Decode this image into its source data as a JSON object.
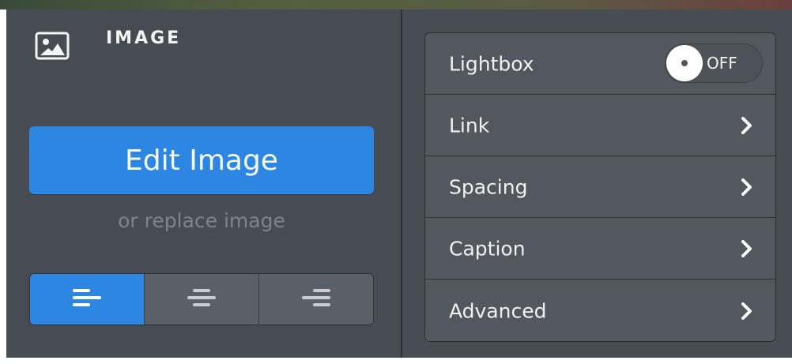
{
  "header": {
    "title": "IMAGE",
    "icon": "image-icon"
  },
  "actions": {
    "edit_label": "Edit Image",
    "replace_label": "or replace image"
  },
  "alignment": {
    "options": [
      {
        "icon": "align-left-icon",
        "active": true
      },
      {
        "icon": "align-center-icon",
        "active": false
      },
      {
        "icon": "align-right-icon",
        "active": false
      }
    ]
  },
  "settings": {
    "lightbox": {
      "label": "Lightbox",
      "state": "OFF"
    },
    "items": [
      {
        "label": "Link",
        "icon": "chevron-right-icon"
      },
      {
        "label": "Spacing",
        "icon": "chevron-right-icon"
      },
      {
        "label": "Caption",
        "icon": "chevron-right-icon"
      },
      {
        "label": "Advanced",
        "icon": "chevron-right-icon"
      }
    ]
  },
  "colors": {
    "accent": "#2e86e3",
    "panel": "#474c52",
    "row": "#53585f"
  }
}
